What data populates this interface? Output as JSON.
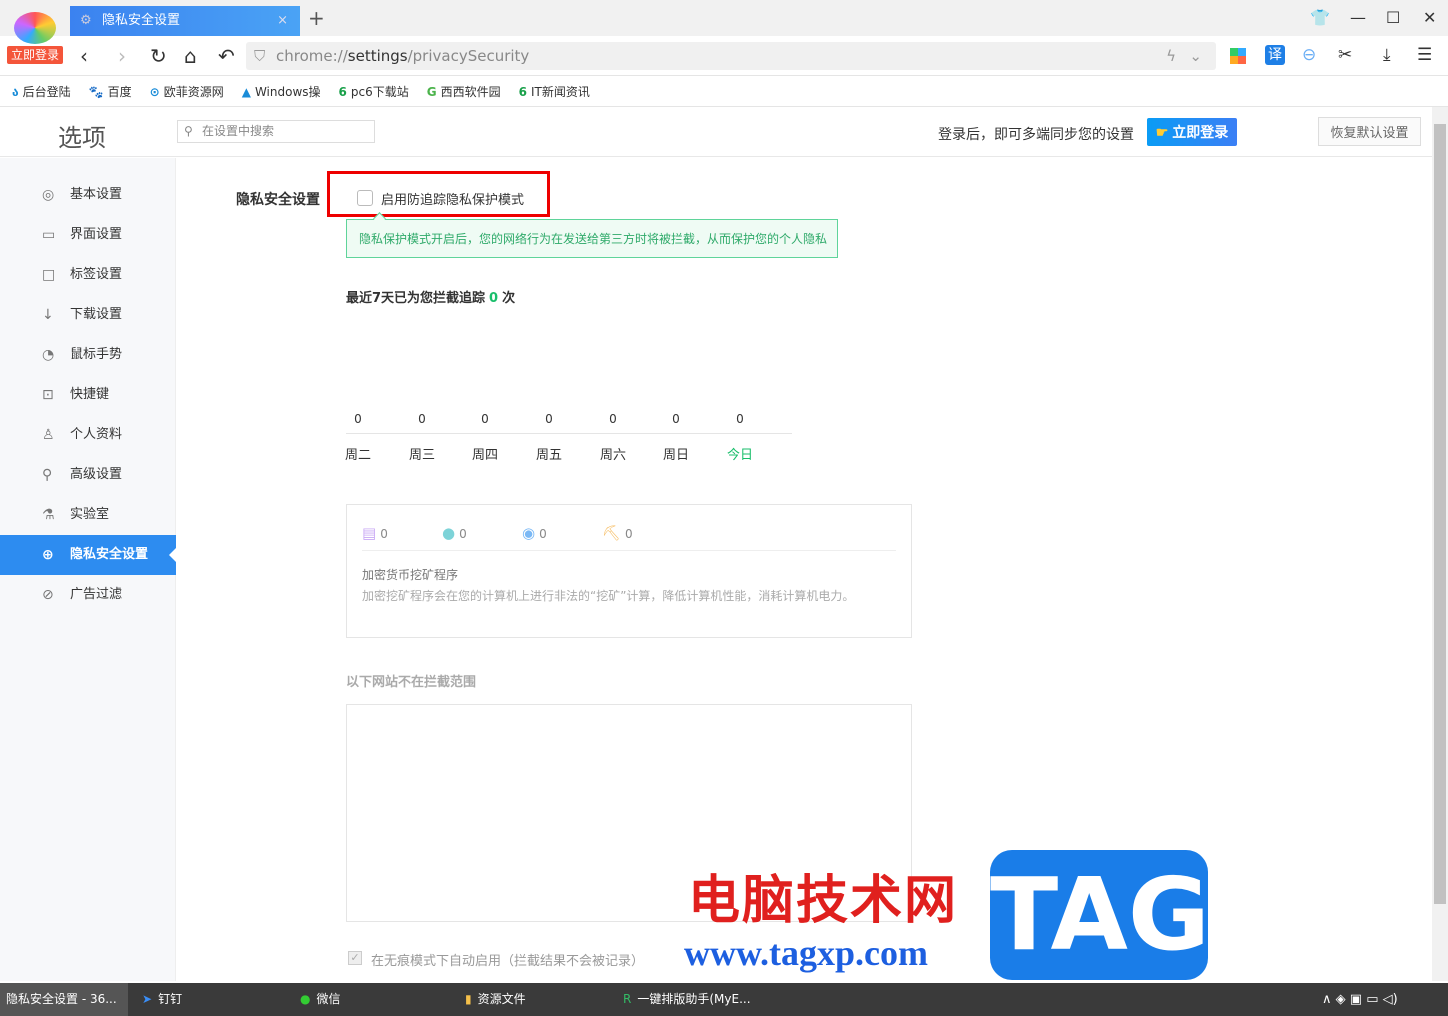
{
  "browser": {
    "login_badge": "立即登录",
    "tab_title": "隐私安全设置",
    "url_prefix": "chrome://",
    "url_host": "settings",
    "url_path": "/privacySecurity",
    "translate_icon": "译",
    "bookmarks": [
      {
        "label": "后台登陆",
        "icon": "ა"
      },
      {
        "label": "百度",
        "icon": "🐾"
      },
      {
        "label": "欧菲资源网",
        "icon": "⊙"
      },
      {
        "label": "Windows操",
        "icon": "▲"
      },
      {
        "label": "pc6下载站",
        "icon": "6"
      },
      {
        "label": "西西软件园",
        "icon": "G"
      },
      {
        "label": "IT新闻资讯",
        "icon": "6"
      }
    ]
  },
  "header": {
    "title": "选项",
    "search_placeholder": "在设置中搜索",
    "sync_text": "登录后，即可多端同步您的设置",
    "login_button": "立即登录",
    "reset_button": "恢复默认设置"
  },
  "sidebar": {
    "items": [
      {
        "label": "基本设置",
        "icon": "◎"
      },
      {
        "label": "界面设置",
        "icon": "▭"
      },
      {
        "label": "标签设置",
        "icon": "□"
      },
      {
        "label": "下载设置",
        "icon": "↓"
      },
      {
        "label": "鼠标手势",
        "icon": "◔"
      },
      {
        "label": "快捷键",
        "icon": "⊡"
      },
      {
        "label": "个人资料",
        "icon": "♙"
      },
      {
        "label": "高级设置",
        "icon": "⚲"
      },
      {
        "label": "实验室",
        "icon": "⚗"
      },
      {
        "label": "隐私安全设置",
        "icon": "⊕",
        "active": true
      },
      {
        "label": "广告过滤",
        "icon": "⊘"
      }
    ]
  },
  "privacy": {
    "section_label": "隐私安全设置",
    "checkbox_label": "启用防追踪隐私保护模式",
    "checkbox_checked": false,
    "tip": "隐私保护模式开启后，您的网络行为在发送给第三方时将被拦截，从而保护您的个人隐私",
    "week_prefix": "最近7天已为您拦截追踪",
    "week_count": "0",
    "week_suffix": "次",
    "days": [
      {
        "day": "周二",
        "value": "0"
      },
      {
        "day": "周三",
        "value": "0"
      },
      {
        "day": "周四",
        "value": "0"
      },
      {
        "day": "周五",
        "value": "0"
      },
      {
        "day": "周六",
        "value": "0"
      },
      {
        "day": "周日",
        "value": "0"
      },
      {
        "day": "今日",
        "value": "0"
      }
    ],
    "stats": [
      {
        "icon": "chat-icon",
        "value": "0",
        "color": "#c9a8f5"
      },
      {
        "icon": "cookie-icon",
        "value": "0",
        "color": "#7dd3d8"
      },
      {
        "icon": "fingerprint-icon",
        "value": "0",
        "color": "#7ab8f5"
      },
      {
        "icon": "miner-icon",
        "value": "0",
        "color": "#f7c06b"
      }
    ],
    "mining_title": "加密货币挖矿程序",
    "mining_desc": "加密挖矿程序会在您的计算机上进行非法的“挖矿”计算，降低计算机性能，消耗计算机电力。",
    "exclusion_title": "以下网站不在拦截范围",
    "incognito_label": "在无痕模式下自动启用（拦截结果不会被记录）",
    "incognito_checked": true,
    "accent": "#19be6b"
  },
  "watermark": {
    "cn": "电脑技术网",
    "url": "www.tagxp.com",
    "tag": "TAG"
  },
  "taskbar": {
    "items": [
      "隐私安全设置 - 36...",
      "钉钉",
      "微信",
      "资源文件",
      "一键排版助手(MyE..."
    ]
  }
}
